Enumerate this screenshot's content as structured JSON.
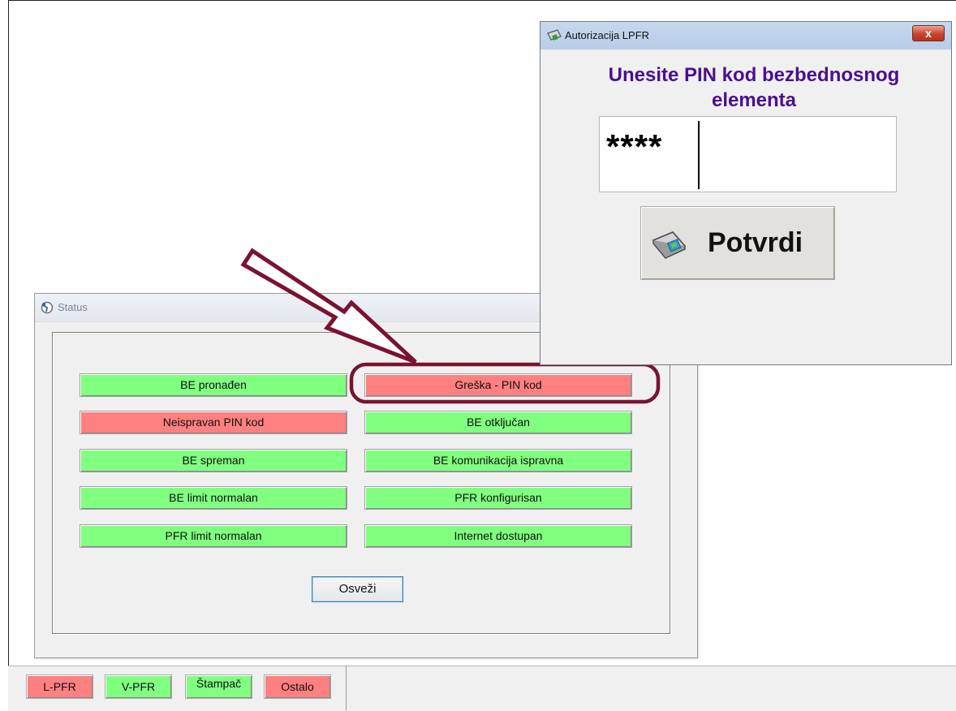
{
  "status_window": {
    "title": "Status",
    "indicators": [
      {
        "label": "BE pronađen",
        "state": "ok"
      },
      {
        "label": "Greška - PIN kod",
        "state": "error"
      },
      {
        "label": "Neispravan PIN kod",
        "state": "error"
      },
      {
        "label": "BE otključan",
        "state": "ok"
      },
      {
        "label": "BE spreman",
        "state": "ok"
      },
      {
        "label": "BE komunikacija ispravna",
        "state": "ok"
      },
      {
        "label": "BE limit normalan",
        "state": "ok"
      },
      {
        "label": "PFR konfigurisan",
        "state": "ok"
      },
      {
        "label": "PFR limit normalan",
        "state": "ok"
      },
      {
        "label": "Internet dostupan",
        "state": "ok"
      }
    ],
    "refresh_label": "Osveži"
  },
  "auth_window": {
    "title": "Autorizacija LPFR",
    "close_label": "x",
    "heading_line1": "Unesite PIN kod bezbednosnog",
    "heading_line2": "elementa",
    "pin_value": "****",
    "confirm_label": "Potvrdi"
  },
  "bottom_bar": {
    "items": [
      {
        "label": "L-PFR",
        "state": "error"
      },
      {
        "label": "V-PFR",
        "state": "ok"
      },
      {
        "label": "Štampač",
        "state": "ok"
      },
      {
        "label": "Ostalo",
        "state": "error"
      }
    ]
  },
  "colors": {
    "ok": "#80ff80",
    "error": "#ff8080",
    "heading": "#4b0f8f",
    "annotation": "#7a1230"
  }
}
